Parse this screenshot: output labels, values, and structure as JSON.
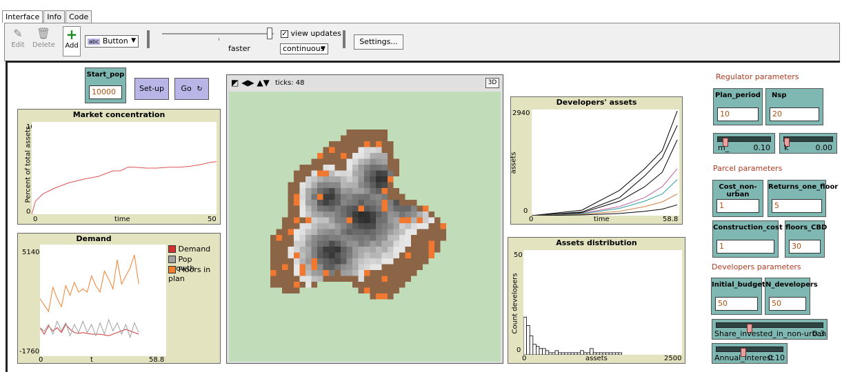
{
  "tabs": [
    "Interface",
    "Info",
    "Code"
  ],
  "toolbar": {
    "edit": "Edit",
    "delete": "Delete",
    "add": "Add",
    "widget_select": "Button",
    "speed_label": "faster",
    "view_updates": "view updates",
    "update_mode": "continuous",
    "settings": "Settings..."
  },
  "buttons": {
    "setup": "Set-up",
    "go": "Go"
  },
  "inputs": {
    "start_pop": {
      "label": "Start_pop",
      "value": "10000"
    },
    "plan_period": {
      "label": "Plan_period",
      "value": "10"
    },
    "nsp": {
      "label": "Nsp",
      "value": "20"
    },
    "cost_non_urban": {
      "label": "Cost_non-urban",
      "value": "1"
    },
    "returns_one_floor": {
      "label": "Returns_one_floor",
      "value": "5"
    },
    "construction_cost": {
      "label": "Construction_cost",
      "value": "1"
    },
    "floors_cbd": {
      "label": "floors_CBD",
      "value": "30"
    },
    "initial_budget": {
      "label": "Initial_budget",
      "value": "50"
    },
    "n_developers": {
      "label": "N_developers",
      "value": "50"
    }
  },
  "sliders": {
    "m": {
      "label": "m_",
      "value": "0.10",
      "fraction": 0.1
    },
    "k": {
      "label": "k",
      "value": "0.00",
      "fraction": 0.0
    },
    "share": {
      "label": "Share_invested_in_non-urban",
      "value": "0.3",
      "fraction": 0.3
    },
    "interest": {
      "label": "Annual_interest",
      "value": "0.10",
      "fraction": 0.4
    }
  },
  "sections": {
    "regulator": "Regulator parameters",
    "parcel": "Parcel parameters",
    "developers": "Developers parameters"
  },
  "view": {
    "ticks": "ticks: 48",
    "threed": "3D"
  },
  "plots": {
    "market": {
      "title": "Market concentration",
      "ylabel": "Percent of total assets",
      "xlabel": "time",
      "ymax": "100",
      "ymin": "0",
      "xmin": "0",
      "xmax": "50"
    },
    "demand": {
      "title": "Demand",
      "ylabel": "",
      "xlabel": "t",
      "ymax": "5140",
      "ymin": "-1760",
      "xmin": "0",
      "xmax": "58.8",
      "legend": [
        {
          "name": "Demand",
          "color": "#d03030"
        },
        {
          "name": "Pop growth",
          "color": "#a0a0a0"
        },
        {
          "name": "Floors in plan",
          "color": "#f08030"
        }
      ]
    },
    "assets": {
      "title": "Developers' assets",
      "ylabel": "assets",
      "xlabel": "time",
      "ymax": "2940",
      "ymin": "0",
      "xmin": "0",
      "xmax": "58.8"
    },
    "dist": {
      "title": "Assets distribution",
      "ylabel": "Count developers",
      "xlabel": "assets",
      "ymax": "50",
      "ymin": "0",
      "xmin": "0",
      "xmax": "2500"
    }
  },
  "chart_data": [
    {
      "type": "line",
      "title": "Market concentration",
      "xlabel": "time",
      "ylabel": "Percent of total assets",
      "xlim": [
        0,
        50
      ],
      "ylim": [
        0,
        100
      ],
      "series": [
        {
          "values": [
            [
              0,
              0
            ],
            [
              1,
              14
            ],
            [
              3,
              22
            ],
            [
              6,
              28
            ],
            [
              10,
              34
            ],
            [
              14,
              38
            ],
            [
              18,
              41
            ],
            [
              20,
              44
            ],
            [
              22,
              47
            ],
            [
              24,
              47
            ],
            [
              26,
              51
            ],
            [
              28,
              51
            ],
            [
              31,
              50
            ],
            [
              34,
              50
            ],
            [
              37,
              51
            ],
            [
              40,
              51
            ],
            [
              43,
              52
            ],
            [
              46,
              54
            ],
            [
              48,
              56
            ],
            [
              50,
              57
            ]
          ]
        }
      ]
    },
    {
      "type": "line",
      "title": "Demand",
      "xlabel": "t",
      "xlim": [
        0,
        58.8
      ],
      "ylim": [
        -1760,
        5140
      ],
      "series": [
        {
          "name": "Demand",
          "values": [
            [
              0,
              0
            ],
            [
              2,
              -400
            ],
            [
              4,
              100
            ],
            [
              6,
              -200
            ],
            [
              8,
              0
            ],
            [
              10,
              -300
            ],
            [
              12,
              200
            ],
            [
              14,
              -100
            ],
            [
              16,
              -300
            ],
            [
              18,
              -350
            ],
            [
              20,
              -300
            ],
            [
              24,
              -400
            ],
            [
              28,
              -400
            ],
            [
              32,
              -500
            ],
            [
              36,
              -300
            ],
            [
              38,
              -200
            ],
            [
              40,
              -100
            ],
            [
              42,
              -200
            ],
            [
              44,
              -300
            ],
            [
              46,
              -400
            ]
          ]
        },
        {
          "name": "Pop growth",
          "values": [
            [
              0,
              0
            ],
            [
              2,
              -200
            ],
            [
              4,
              200
            ],
            [
              6,
              -400
            ],
            [
              8,
              400
            ],
            [
              10,
              -200
            ],
            [
              12,
              300
            ],
            [
              14,
              -500
            ],
            [
              16,
              200
            ],
            [
              18,
              -300
            ],
            [
              20,
              400
            ],
            [
              22,
              -300
            ],
            [
              24,
              200
            ],
            [
              26,
              -500
            ],
            [
              28,
              300
            ],
            [
              30,
              -400
            ],
            [
              32,
              500
            ],
            [
              34,
              -200
            ],
            [
              36,
              300
            ],
            [
              38,
              -400
            ],
            [
              40,
              200
            ],
            [
              42,
              -600
            ],
            [
              44,
              300
            ],
            [
              46,
              -300
            ]
          ]
        },
        {
          "name": "Floors in plan",
          "values": [
            [
              0,
              1800
            ],
            [
              2,
              1400
            ],
            [
              4,
              1000
            ],
            [
              6,
              2500
            ],
            [
              8,
              1800
            ],
            [
              10,
              1300
            ],
            [
              12,
              2600
            ],
            [
              14,
              2000
            ],
            [
              16,
              2800
            ],
            [
              18,
              2200
            ],
            [
              20,
              2400
            ],
            [
              22,
              2200
            ],
            [
              24,
              3200
            ],
            [
              26,
              2600
            ],
            [
              28,
              2200
            ],
            [
              30,
              3500
            ],
            [
              32,
              3000
            ],
            [
              34,
              2400
            ],
            [
              36,
              4200
            ],
            [
              38,
              2700
            ],
            [
              40,
              3200
            ],
            [
              42,
              3700
            ],
            [
              44,
              4500
            ],
            [
              46,
              2700
            ]
          ]
        }
      ]
    },
    {
      "type": "line",
      "title": "Developers' assets",
      "xlabel": "time",
      "ylabel": "assets",
      "xlim": [
        0,
        58.8
      ],
      "ylim": [
        0,
        2940
      ],
      "series": [
        {
          "values": [
            [
              0,
              0
            ],
            [
              20,
              150
            ],
            [
              35,
              700
            ],
            [
              45,
              1300
            ],
            [
              52,
              1800
            ],
            [
              58,
              2900
            ]
          ]
        },
        {
          "values": [
            [
              0,
              0
            ],
            [
              20,
              100
            ],
            [
              35,
              500
            ],
            [
              45,
              1100
            ],
            [
              52,
              1600
            ],
            [
              58,
              2500
            ]
          ]
        },
        {
          "values": [
            [
              0,
              0
            ],
            [
              20,
              80
            ],
            [
              35,
              400
            ],
            [
              45,
              800
            ],
            [
              52,
              1200
            ],
            [
              58,
              2100
            ]
          ]
        },
        {
          "values": [
            [
              0,
              0
            ],
            [
              20,
              60
            ],
            [
              35,
              250
            ],
            [
              45,
              500
            ],
            [
              52,
              800
            ],
            [
              58,
              1300
            ]
          ]
        },
        {
          "values": [
            [
              0,
              0
            ],
            [
              20,
              50
            ],
            [
              35,
              200
            ],
            [
              45,
              400
            ],
            [
              52,
              600
            ],
            [
              58,
              1000
            ]
          ]
        },
        {
          "values": [
            [
              0,
              0
            ],
            [
              20,
              30
            ],
            [
              35,
              120
            ],
            [
              45,
              250
            ],
            [
              52,
              380
            ],
            [
              58,
              600
            ]
          ]
        },
        {
          "values": [
            [
              0,
              0
            ],
            [
              20,
              20
            ],
            [
              35,
              60
            ],
            [
              45,
              120
            ],
            [
              52,
              180
            ],
            [
              58,
              300
            ]
          ]
        }
      ]
    },
    {
      "type": "bar",
      "title": "Assets distribution",
      "xlabel": "assets",
      "ylabel": "Count developers",
      "xlim": [
        0,
        2500
      ],
      "ylim": [
        0,
        50
      ],
      "categories": [
        0,
        50,
        100,
        150,
        200,
        250,
        300,
        350,
        400,
        450,
        500,
        550,
        600,
        650,
        700,
        750,
        800,
        850,
        900,
        950,
        1000,
        1050,
        1100,
        1150,
        1200,
        1250,
        1300,
        1350,
        1400,
        1450,
        1500
      ],
      "values": [
        18,
        14,
        9,
        5,
        4,
        3,
        3,
        2,
        1,
        1,
        2,
        1,
        1,
        1,
        1,
        1,
        1,
        1,
        2,
        1,
        1,
        3,
        1,
        1,
        1,
        1,
        1,
        1,
        1,
        1,
        1
      ]
    }
  ]
}
